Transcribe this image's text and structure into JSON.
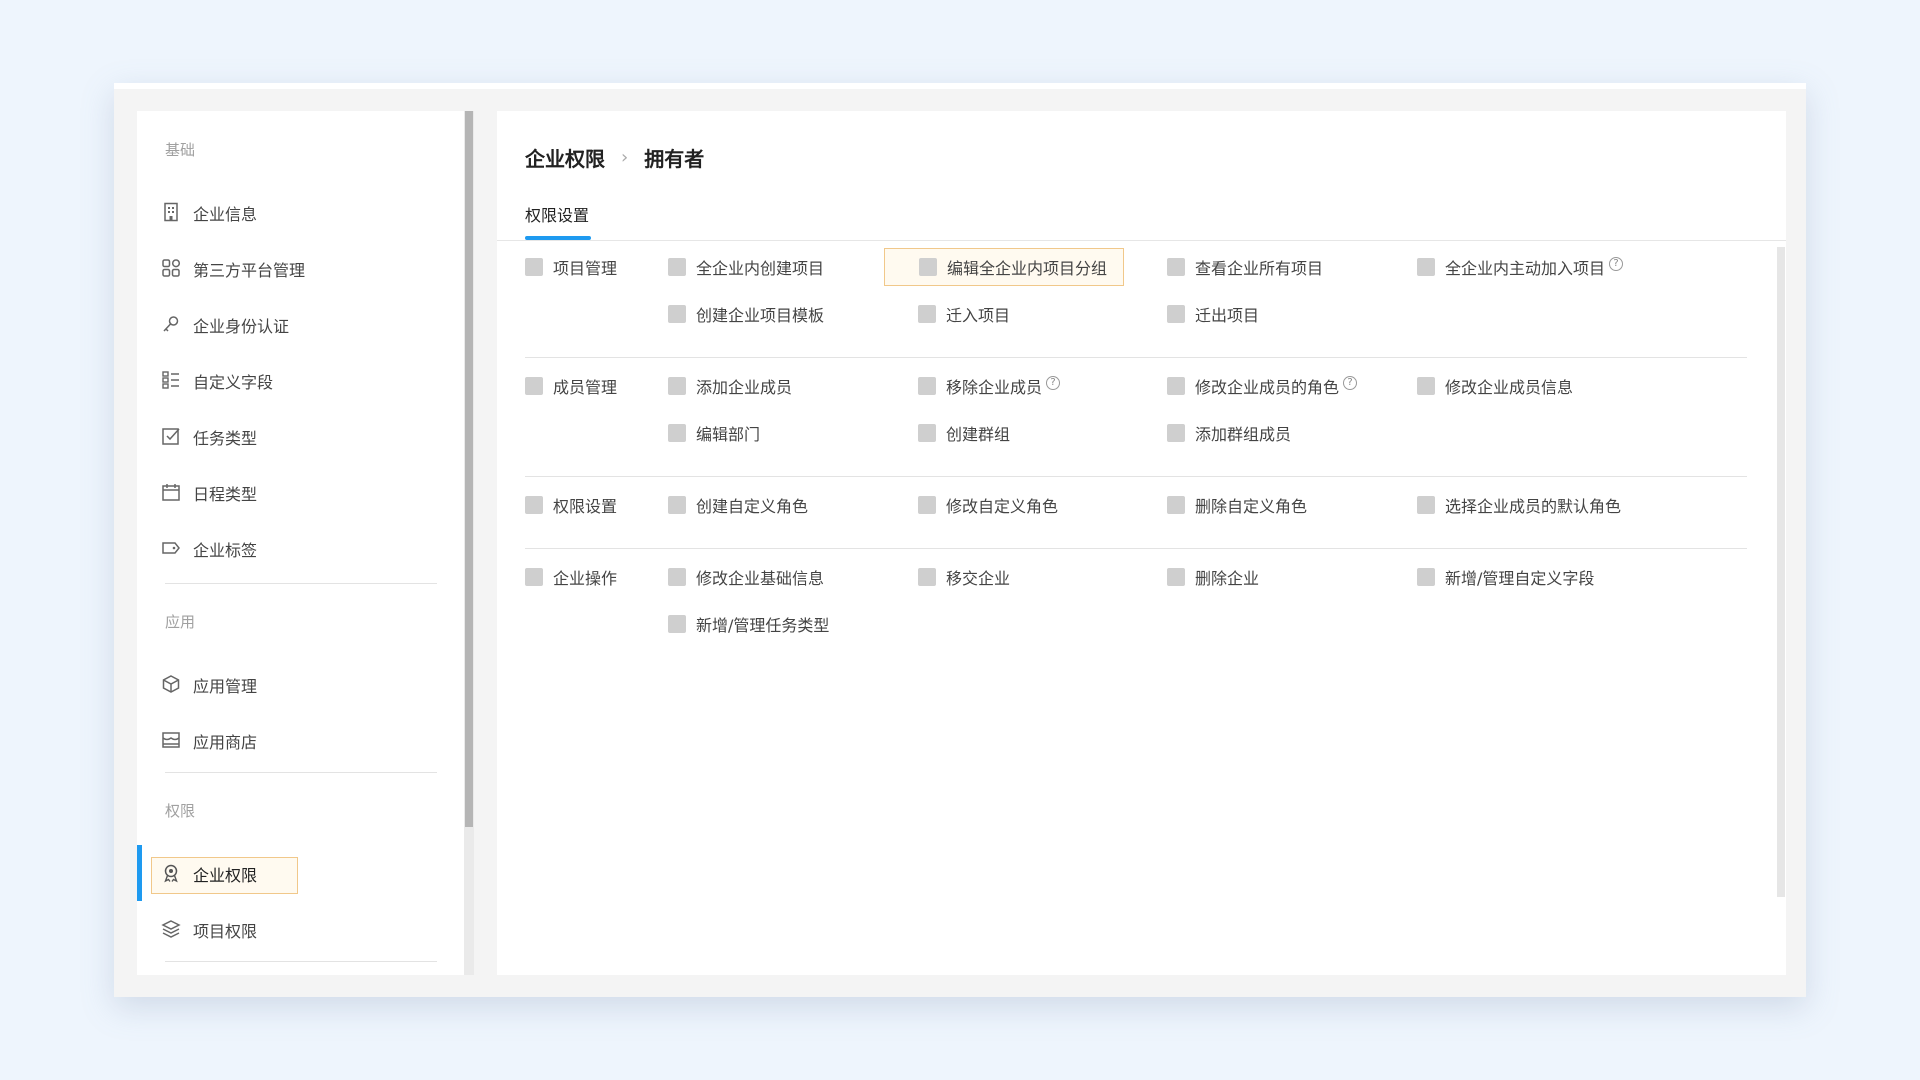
{
  "sidebar": {
    "sections": [
      {
        "title": "基础",
        "items": [
          {
            "label": "企业信息",
            "icon": "building-icon"
          },
          {
            "label": "第三方平台管理",
            "icon": "grid-icon"
          },
          {
            "label": "企业身份认证",
            "icon": "key-icon"
          },
          {
            "label": "自定义字段",
            "icon": "list-icon"
          },
          {
            "label": "任务类型",
            "icon": "checkbox-icon"
          },
          {
            "label": "日程类型",
            "icon": "calendar-icon"
          },
          {
            "label": "企业标签",
            "icon": "tag-icon"
          }
        ]
      },
      {
        "title": "应用",
        "items": [
          {
            "label": "应用管理",
            "icon": "cube-icon"
          },
          {
            "label": "应用商店",
            "icon": "store-icon"
          }
        ]
      },
      {
        "title": "权限",
        "items": [
          {
            "label": "企业权限",
            "icon": "badge-icon",
            "active": true
          },
          {
            "label": "项目权限",
            "icon": "layers-icon"
          }
        ]
      }
    ]
  },
  "breadcrumb": {
    "root": "企业权限",
    "current": "拥有者"
  },
  "tabs": {
    "active": "权限设置"
  },
  "groups": [
    {
      "title": "项目管理",
      "items": [
        "全企业内创建项目",
        "编辑全企业内项目分组",
        "查看企业所有项目",
        "全企业内主动加入项目",
        "创建企业项目模板",
        "迁入项目",
        "迁出项目"
      ]
    },
    {
      "title": "成员管理",
      "items": [
        "添加企业成员",
        "移除企业成员",
        "修改企业成员的角色",
        "修改企业成员信息",
        "编辑部门",
        "创建群组",
        "添加群组成员"
      ]
    },
    {
      "title": "权限设置",
      "items": [
        "创建自定义角色",
        "修改自定义角色",
        "删除自定义角色",
        "选择企业成员的默认角色"
      ]
    },
    {
      "title": "企业操作",
      "items": [
        "修改企业基础信息",
        "移交企业",
        "删除企业",
        "新增/管理自定义字段",
        "新增/管理任务类型"
      ]
    }
  ],
  "colors": {
    "accent": "#1e9af0",
    "highlight_border": "#f1c88a",
    "checkbox": "#cfcfcf"
  }
}
